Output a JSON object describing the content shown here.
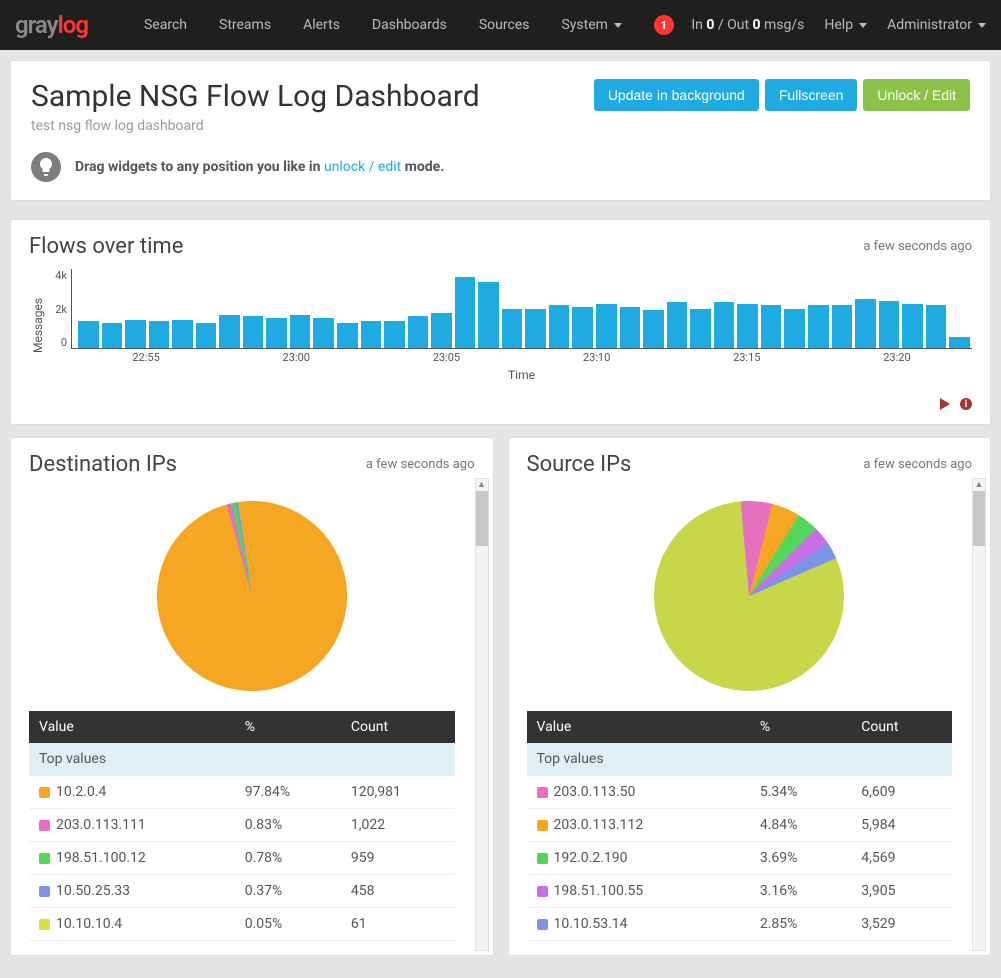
{
  "nav": {
    "logo_gray": "gray",
    "logo_log": "log",
    "links": [
      "Search",
      "Streams",
      "Alerts",
      "Dashboards",
      "Sources",
      "System"
    ],
    "badge": "1",
    "inout_prefix": "In ",
    "inout_in": "0",
    "inout_mid": " / Out ",
    "inout_out": "0",
    "inout_suffix": " msg/s",
    "help": "Help",
    "admin": "Administrator"
  },
  "header": {
    "title": "Sample NSG Flow Log Dashboard",
    "subtitle": "test nsg flow log dashboard",
    "btn_update": "Update in background",
    "btn_fullscreen": "Fullscreen",
    "btn_unlock": "Unlock / Edit",
    "hint_pre": "Drag widgets to any position you like in ",
    "hint_link": "unlock / edit",
    "hint_post": " mode."
  },
  "flows": {
    "title": "Flows over time",
    "time": "a few seconds ago",
    "ylabel": "Messages",
    "xlabel": "Time",
    "yticks": [
      "4k",
      "2k",
      "0"
    ]
  },
  "dest": {
    "title": "Destination IPs",
    "time": "a few seconds ago",
    "th_value": "Value",
    "th_pct": "%",
    "th_count": "Count",
    "toprow": "Top values"
  },
  "src": {
    "title": "Source IPs",
    "time": "a few seconds ago",
    "th_value": "Value",
    "th_pct": "%",
    "th_count": "Count",
    "toprow": "Top values"
  },
  "chart_data": [
    {
      "type": "bar",
      "title": "Flows over time",
      "xlabel": "Time",
      "ylabel": "Messages",
      "ylim": [
        0,
        5000
      ],
      "x_tick_labels": [
        "22:55",
        "23:00",
        "23:05",
        "23:10",
        "23:15",
        "23:20"
      ],
      "values": [
        1700,
        1600,
        1800,
        1700,
        1800,
        1600,
        2100,
        2000,
        1900,
        2100,
        1900,
        1600,
        1700,
        1700,
        2000,
        2200,
        4500,
        4200,
        2500,
        2500,
        2700,
        2600,
        2800,
        2600,
        2400,
        2900,
        2500,
        2900,
        2800,
        2700,
        2500,
        2700,
        2700,
        3100,
        3000,
        2800,
        2700,
        700
      ]
    },
    {
      "type": "pie",
      "title": "Destination IPs",
      "series": [
        {
          "name": "10.2.0.4",
          "pct": 97.84,
          "count": 120981,
          "color": "#f5a623"
        },
        {
          "name": "203.0.113.111",
          "pct": 0.83,
          "count": 1022,
          "color": "#e66fbf"
        },
        {
          "name": "198.51.100.12",
          "pct": 0.78,
          "count": 959,
          "color": "#54d65a"
        },
        {
          "name": "10.50.25.33",
          "pct": 0.37,
          "count": 458,
          "color": "#7a95e6"
        },
        {
          "name": "10.10.10.4",
          "pct": 0.05,
          "count": 61,
          "color": "#d7e04a"
        }
      ]
    },
    {
      "type": "pie",
      "title": "Source IPs",
      "series": [
        {
          "name": "203.0.113.50",
          "pct": 5.34,
          "count": 6609,
          "color": "#e66fbf"
        },
        {
          "name": "203.0.113.112",
          "pct": 4.84,
          "count": 5984,
          "color": "#f5a623"
        },
        {
          "name": "192.0.2.190",
          "pct": 3.69,
          "count": 4569,
          "color": "#54d65a"
        },
        {
          "name": "198.51.100.55",
          "pct": 3.16,
          "count": 3905,
          "color": "#c66fe6"
        },
        {
          "name": "10.10.53.14",
          "pct": 2.85,
          "count": 3529,
          "color": "#7a95e6"
        }
      ],
      "remainder_color": "#c8d64a",
      "remainder_pct": 80.12
    }
  ]
}
